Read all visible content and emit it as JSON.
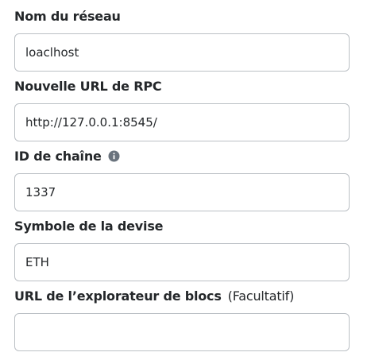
{
  "network_form": {
    "network_name": {
      "label": "Nom du réseau",
      "value": "loaclhost"
    },
    "rpc_url": {
      "label": "Nouvelle URL de RPC",
      "value": "http://127.0.0.1:8545/"
    },
    "chain_id": {
      "label": "ID de chaîne",
      "info_icon": "info-icon",
      "value": "1337"
    },
    "currency_symbol": {
      "label": "Symbole de la devise",
      "value": "ETH"
    },
    "explorer_url": {
      "label": "URL de l’explorateur de blocs",
      "optional_note": "(Facultatif)",
      "value": ""
    }
  },
  "colors": {
    "text": "#24272a",
    "border": "#bbc0c5",
    "icon": "#6a737d",
    "background": "#ffffff"
  }
}
